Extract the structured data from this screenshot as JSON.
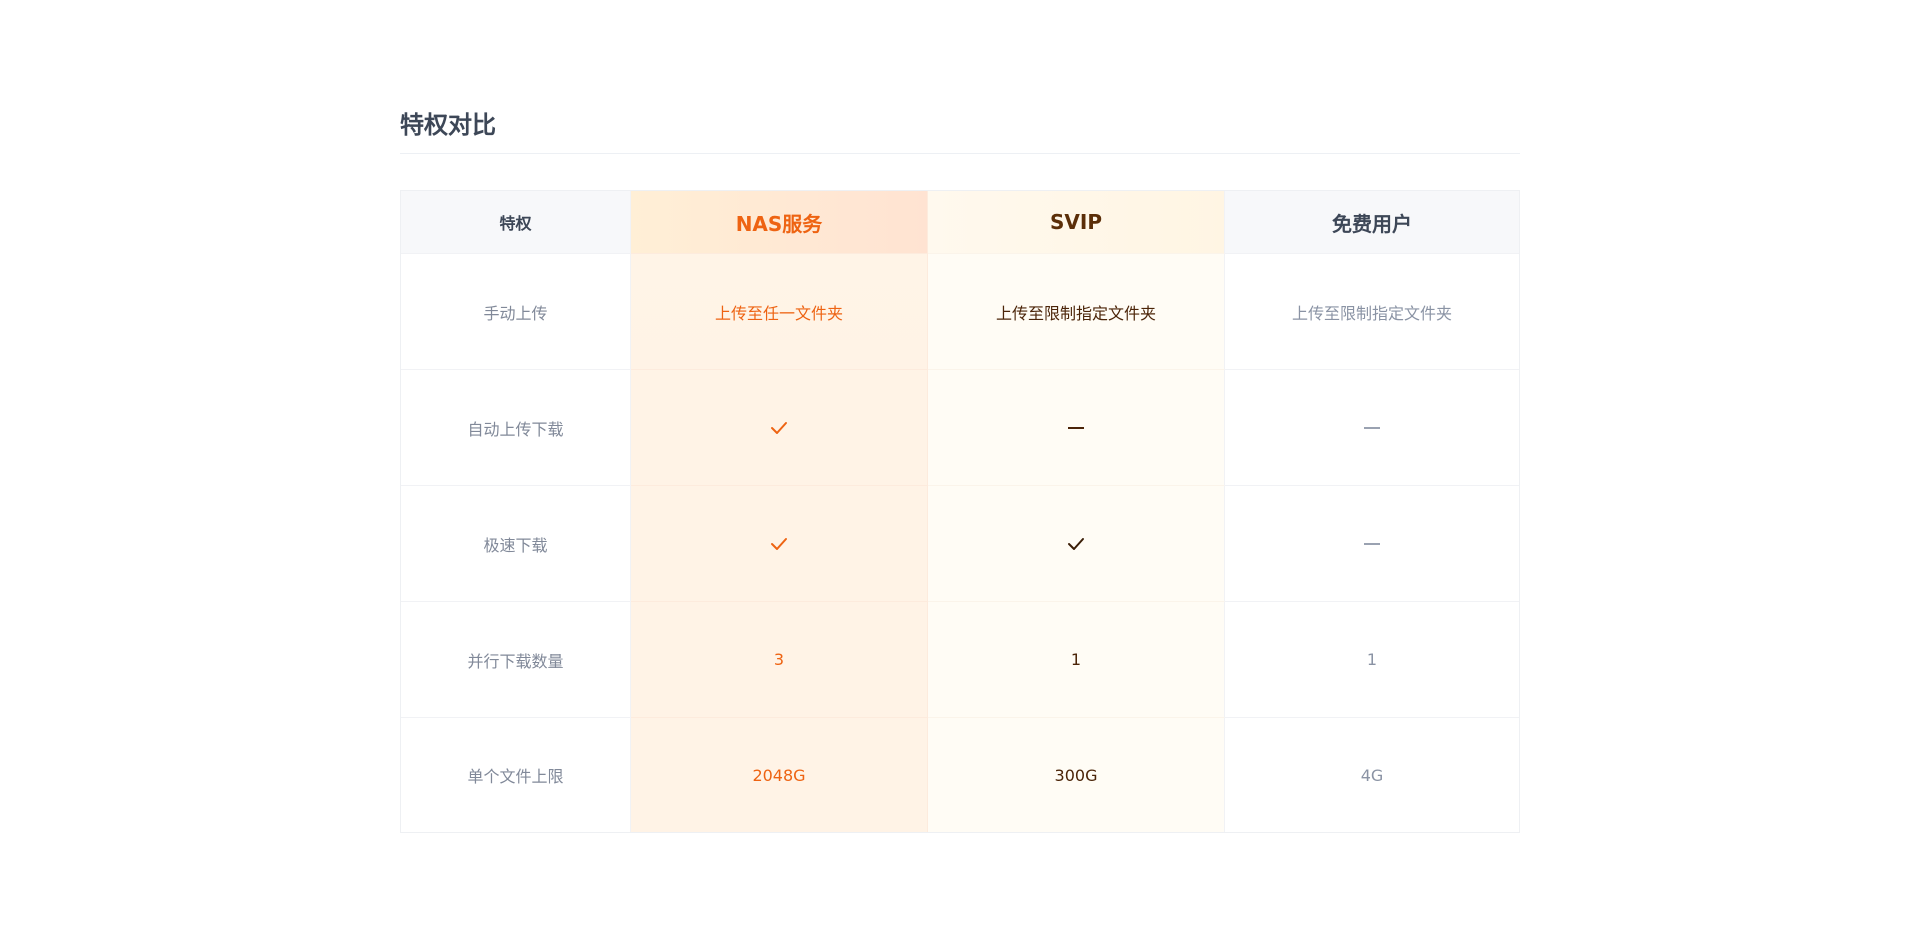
{
  "section": {
    "title": "特权对比"
  },
  "table": {
    "headers": {
      "privilege": "特权",
      "nas": "NAS服务",
      "svip": "SVIP",
      "free": "免费用户"
    },
    "rows": [
      {
        "privilege": "手动上传",
        "nas": "上传至任一文件夹",
        "svip": "上传至限制指定文件夹",
        "free": "上传至限制指定文件夹"
      },
      {
        "privilege": "自动上传下载",
        "nas_icon": "check-icon",
        "svip_icon": "dash-icon",
        "free_icon": "dash-icon"
      },
      {
        "privilege": "极速下载",
        "nas_icon": "check-icon",
        "svip_icon": "check-icon",
        "free_icon": "dash-icon"
      },
      {
        "privilege": "并行下载数量",
        "nas": "3",
        "svip": "1",
        "free": "1"
      },
      {
        "privilege": "单个文件上限",
        "nas": "2048G",
        "svip": "300G",
        "free": "4G"
      }
    ]
  },
  "colors": {
    "nas_accent": "#ee6312",
    "svip_text": "#4b2408",
    "free_text": "#8a93a4",
    "title_text": "#3d4757"
  }
}
